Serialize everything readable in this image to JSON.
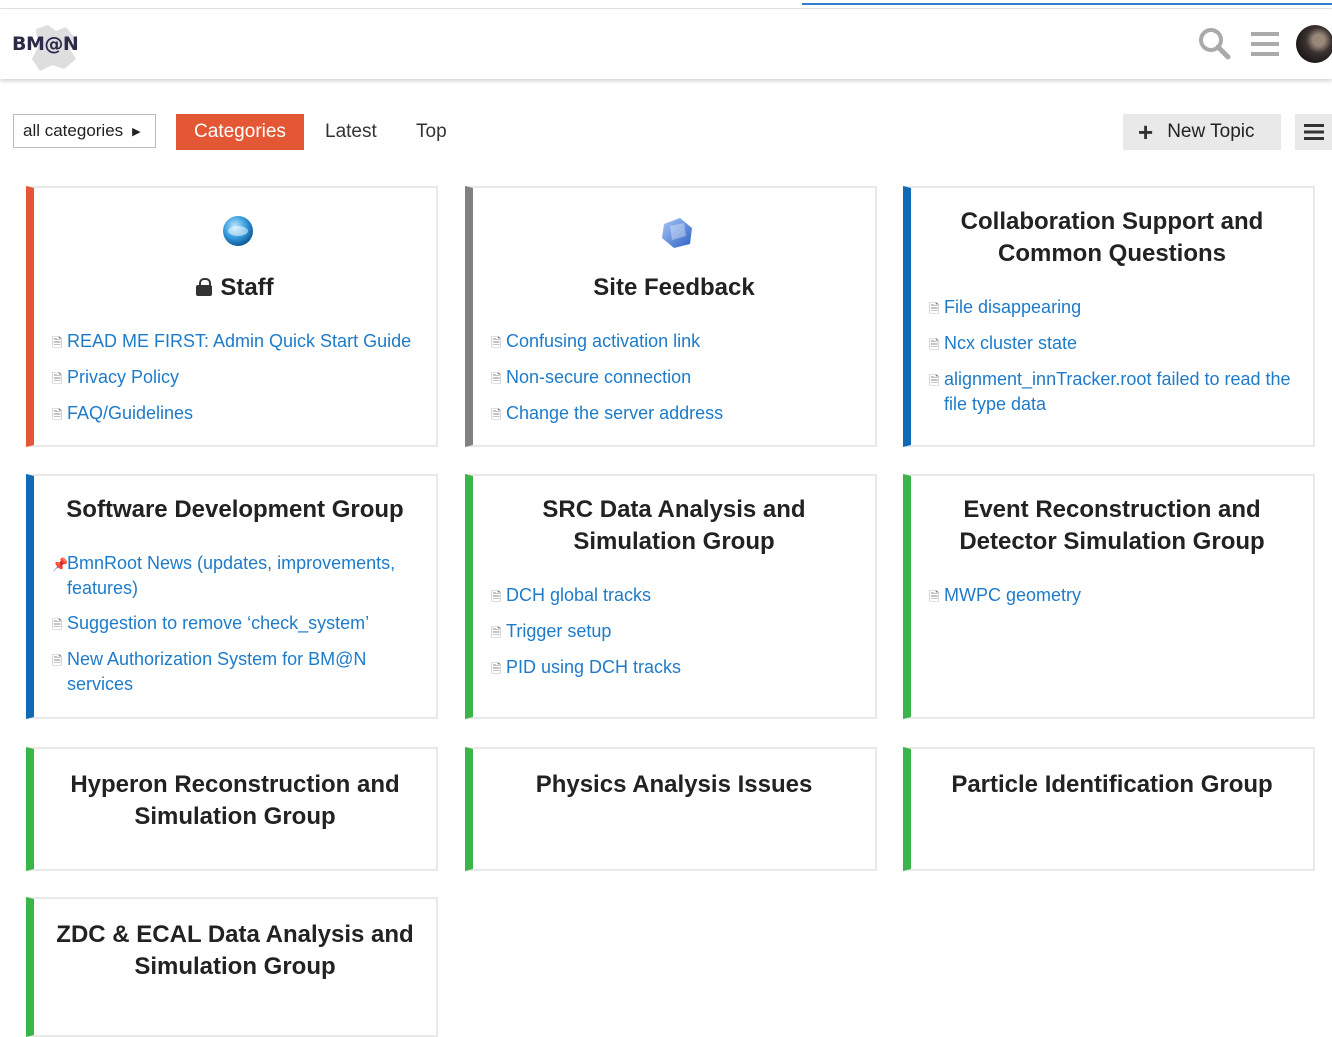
{
  "header": {
    "logo": "BM@N",
    "search_icon": "search-icon",
    "menu_icon": "hamburger-icon",
    "avatar": "user-avatar"
  },
  "nav": {
    "category_dropdown": "all categories",
    "tabs": [
      {
        "label": "Categories",
        "active": true
      },
      {
        "label": "Latest",
        "active": false
      },
      {
        "label": "Top",
        "active": false
      }
    ],
    "new_topic": "New Topic"
  },
  "colors": {
    "accent": "#e45735",
    "link": "#1e7bc9",
    "staff": "#e45735",
    "site_feedback": "#808281",
    "blue": "#0f6bb5",
    "green": "#3ab54a"
  },
  "categories": [
    {
      "name": "Staff",
      "locked": true,
      "icon": "globe-icon",
      "topics": [
        {
          "title": "READ ME FIRST: Admin Quick Start Guide",
          "icon": "document-icon"
        },
        {
          "title": "Privacy Policy",
          "icon": "document-icon"
        },
        {
          "title": "FAQ/Guidelines",
          "icon": "document-icon"
        }
      ]
    },
    {
      "name": "Site Feedback",
      "icon": "feedback-icon",
      "topics": [
        {
          "title": "Confusing activation link",
          "icon": "document-icon"
        },
        {
          "title": "Non-secure connection",
          "icon": "document-icon"
        },
        {
          "title": "Change the server address",
          "icon": "document-icon"
        }
      ]
    },
    {
      "name": "Collaboration Support and Common Questions",
      "topics": [
        {
          "title": "File disappearing",
          "icon": "document-icon"
        },
        {
          "title": "Ncx cluster state",
          "icon": "document-icon"
        },
        {
          "title": "alignment_innTracker.root failed to read the file type data",
          "icon": "document-icon"
        }
      ]
    },
    {
      "name": "Software Development Group",
      "topics": [
        {
          "title": "BmnRoot News (updates, improvements, features)",
          "icon": "pin-icon"
        },
        {
          "title": "Suggestion to remove ‘check_system’",
          "icon": "document-icon"
        },
        {
          "title": "New Authorization System for BM@N services",
          "icon": "document-icon"
        }
      ]
    },
    {
      "name": "SRC Data Analysis and Simulation Group",
      "topics": [
        {
          "title": "DCH global tracks",
          "icon": "document-icon"
        },
        {
          "title": "Trigger setup",
          "icon": "document-icon"
        },
        {
          "title": "PID using DCH tracks",
          "icon": "document-icon"
        }
      ]
    },
    {
      "name": "Event Reconstruction and Detector Simulation Group",
      "topics": [
        {
          "title": "MWPC geometry",
          "icon": "document-icon"
        }
      ]
    },
    {
      "name": "Hyperon Reconstruction and Simulation Group",
      "topics": []
    },
    {
      "name": "Physics Analysis Issues",
      "topics": []
    },
    {
      "name": "Particle Identification Group",
      "topics": []
    },
    {
      "name": "ZDC & ECAL Data Analysis and Simulation Group",
      "topics": []
    }
  ]
}
